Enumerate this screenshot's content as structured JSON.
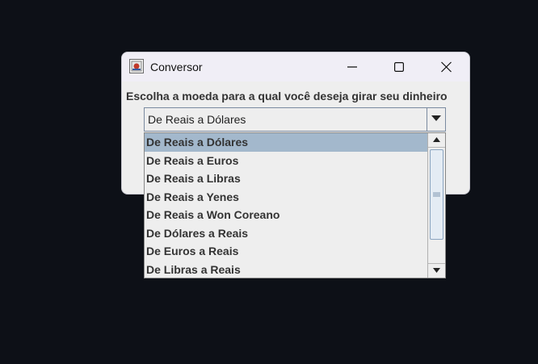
{
  "window": {
    "title": "Conversor",
    "app_icon": "java-app-icon",
    "controls": [
      "minimize-icon",
      "maximize-icon",
      "close-icon"
    ]
  },
  "prompt": "Escolha a moeda para a qual você deseja girar seu dinheiro",
  "combo": {
    "selected": "De Reais a Dólares",
    "arrow_icon": "chevron-down-icon"
  },
  "dropdown": {
    "options": [
      "De Reais a Dólares",
      "De Reais a Euros",
      "De Reais a Libras",
      "De Reais a Yenes",
      "De Reais a Won Coreano",
      "De Dólares a Reais",
      "De Euros a Reais",
      "De Libras a Reais"
    ],
    "highlighted_index": 0,
    "scroll_position": 0
  },
  "colors": {
    "desktop": "#0d1017",
    "highlight": "#a3b8cc",
    "panel": "#eeeeee"
  }
}
